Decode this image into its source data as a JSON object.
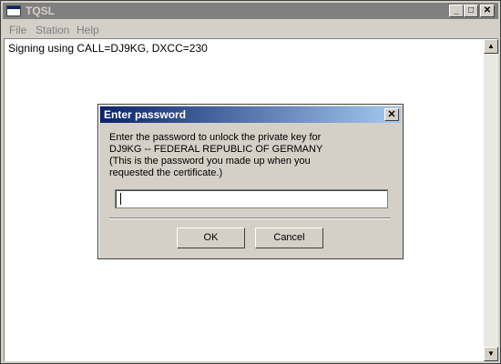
{
  "window": {
    "title": "TQSL",
    "minimize_glyph": "_",
    "maximize_glyph": "□",
    "close_glyph": "✕"
  },
  "menu": [
    "File",
    "Station",
    "Help"
  ],
  "log": {
    "text": "Signing using CALL=DJ9KG, DXCC=230"
  },
  "scrollbar": {
    "up_glyph": "▲",
    "down_glyph": "▼"
  },
  "dialog": {
    "title": "Enter password",
    "close_glyph": "✕",
    "message_lines": [
      "Enter the password to unlock the private key for",
      "DJ9KG -- FEDERAL REPUBLIC OF GERMANY",
      "(This is the password you made up when you",
      "requested the certificate.)"
    ],
    "password_value": "",
    "ok_label": "OK",
    "cancel_label": "Cancel"
  },
  "colors": {
    "title_inactive": "#808080",
    "dialog_title_start": "#0a246a",
    "dialog_title_end": "#a6caf0",
    "face": "#d4d0c8"
  },
  "icons": {
    "app": "window-app-icon",
    "scroll_up": "scroll-up-arrow-icon",
    "scroll_down": "scroll-down-arrow-icon"
  }
}
